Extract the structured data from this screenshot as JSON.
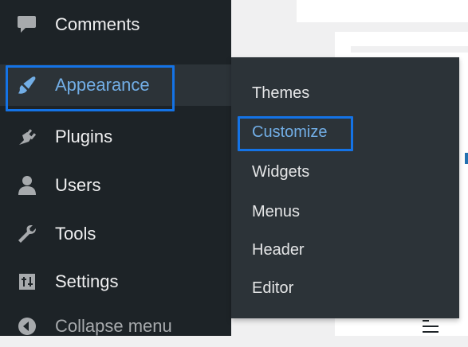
{
  "sidebar": {
    "items": [
      {
        "label": "Comments",
        "icon": "comment-icon"
      },
      {
        "label": "Appearance",
        "icon": "paintbrush-icon"
      },
      {
        "label": "Plugins",
        "icon": "plugin-icon"
      },
      {
        "label": "Users",
        "icon": "user-icon"
      },
      {
        "label": "Tools",
        "icon": "wrench-icon"
      },
      {
        "label": "Settings",
        "icon": "settings-icon"
      }
    ],
    "collapse_label": "Collapse menu"
  },
  "submenu": {
    "items": [
      "Themes",
      "Customize",
      "Widgets",
      "Menus",
      "Header",
      "Editor"
    ]
  },
  "colors": {
    "sidebar_bg": "#1d2327",
    "submenu_bg": "#2c3338",
    "highlight": "#72aee6",
    "annotation_box": "#1473e6"
  }
}
